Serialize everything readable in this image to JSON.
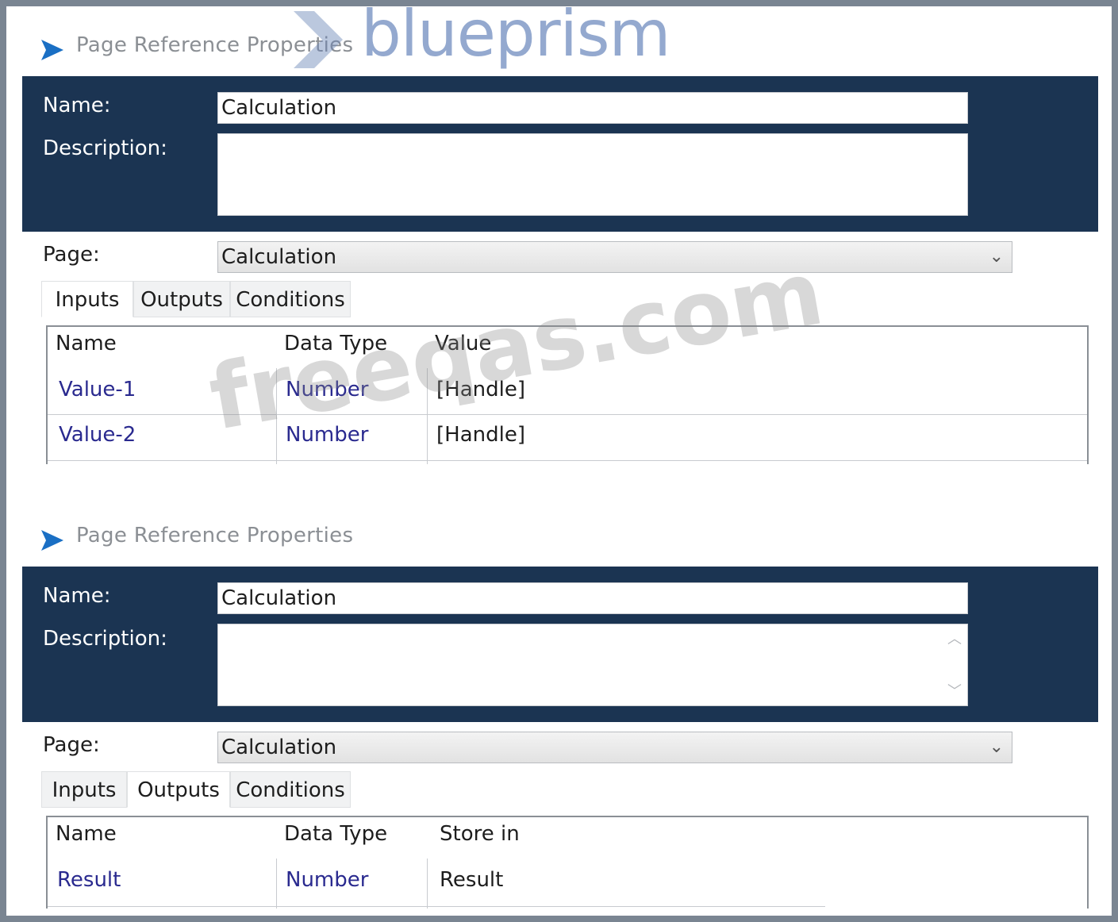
{
  "brand_watermark": "blueprism",
  "site_watermark": "freeqas.com",
  "colors": {
    "header_bg": "#1b3452",
    "frame_bg": "#7a8592",
    "link_text": "#2a2a8f",
    "logo_blue": "#1a6fc4"
  },
  "panels": [
    {
      "title": "Page Reference Properties",
      "name_label": "Name:",
      "name_value": "Calculation",
      "description_label": "Description:",
      "description_value": "",
      "page_label": "Page:",
      "page_value": "Calculation",
      "tabs": [
        "Inputs",
        "Outputs",
        "Conditions"
      ],
      "active_tab": "Inputs",
      "columns": [
        "Name",
        "Data Type",
        "Value"
      ],
      "rows": [
        {
          "name": "Value-1",
          "type": "Number",
          "value": "[Handle]"
        },
        {
          "name": "Value-2",
          "type": "Number",
          "value": "[Handle]"
        }
      ]
    },
    {
      "title": "Page Reference Properties",
      "name_label": "Name:",
      "name_value": "Calculation",
      "description_label": "Description:",
      "description_value": "",
      "page_label": "Page:",
      "page_value": "Calculation",
      "tabs": [
        "Inputs",
        "Outputs",
        "Conditions"
      ],
      "active_tab": "Outputs",
      "columns": [
        "Name",
        "Data Type",
        "Store in"
      ],
      "rows": [
        {
          "name": "Result",
          "type": "Number",
          "value": "Result"
        }
      ]
    }
  ]
}
